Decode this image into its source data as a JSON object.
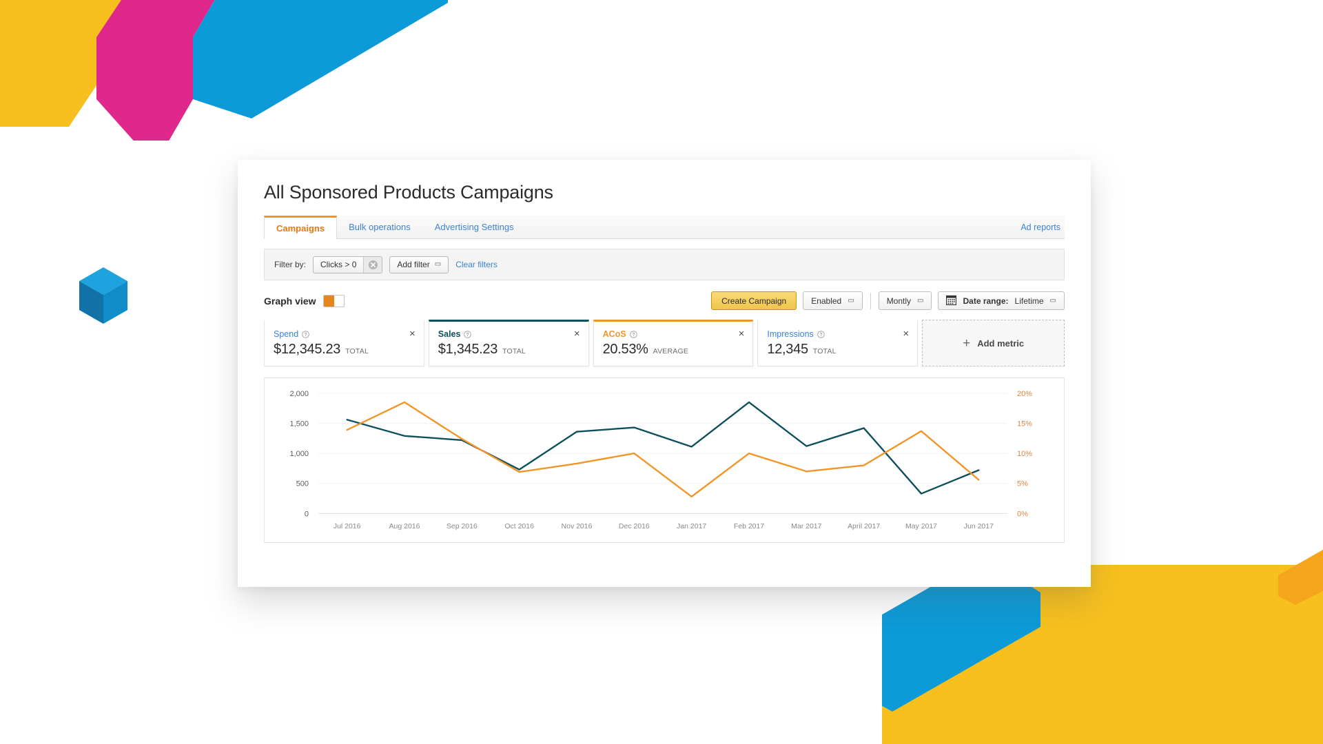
{
  "page": {
    "title": "All Sponsored Products Campaigns"
  },
  "tabs": [
    {
      "label": "Campaigns",
      "active": true
    },
    {
      "label": "Bulk operations",
      "active": false
    },
    {
      "label": "Advertising Settings",
      "active": false
    }
  ],
  "tab_right_link": "Ad reports",
  "filter_bar": {
    "label": "Filter by:",
    "chips": [
      {
        "label": "Clicks > 0"
      }
    ],
    "add_filter": "Add filter",
    "clear_filters": "Clear filters"
  },
  "graph_row": {
    "label": "Graph view",
    "toggle_state": "on",
    "create_campaign": "Create Campaign",
    "status_filter": "Enabled",
    "granularity": "Montly",
    "date_range_label": "Date range:",
    "date_range_value": "Lifetime"
  },
  "metrics": [
    {
      "name": "Spend",
      "value": "$12,345.23",
      "unit": "TOTAL",
      "color": "#3c82d4",
      "state": "link",
      "close": "×"
    },
    {
      "name": "Sales",
      "value": "$1,345.23",
      "unit": "TOTAL",
      "color": "#0d4f5c",
      "state": "teal",
      "close": "×"
    },
    {
      "name": "ACoS",
      "value": "20.53%",
      "unit": "AVERAGE",
      "color": "#f0952a",
      "state": "orange",
      "close": "×"
    },
    {
      "name": "Impressions",
      "value": "12,345",
      "unit": "TOTAL",
      "color": "#3c82d4",
      "state": "link",
      "close": "×"
    }
  ],
  "add_metric": {
    "label": "Add metric",
    "plus": "+"
  },
  "chart_data": {
    "type": "line",
    "title": "",
    "xlabel": "",
    "ylabel": "",
    "grid": true,
    "legend": "none",
    "x": [
      "Jul 2016",
      "Aug 2016",
      "Sep 2016",
      "Oct 2016",
      "Nov 2016",
      "Dec 2016",
      "Jan 2017",
      "Feb 2017",
      "Mar 2017",
      "April 2017",
      "May 2017",
      "Jun 2017"
    ],
    "left_axis": {
      "ticks": [
        "0",
        "500",
        "1,000",
        "1,500",
        "2,000"
      ],
      "values": [
        0,
        500,
        1000,
        1500,
        2000
      ],
      "min": 0,
      "max": 2000,
      "color": "#5a5a5a"
    },
    "right_axis": {
      "ticks": [
        "0%",
        "5%",
        "10%",
        "15%",
        "20%"
      ],
      "values": [
        0,
        5,
        10,
        15,
        20
      ],
      "min": 0,
      "max": 20,
      "color": "#d98642"
    },
    "series": [
      {
        "name": "Sales",
        "axis": "left",
        "color": "#0d4f5c",
        "values": [
          1560,
          1290,
          1220,
          730,
          1360,
          1430,
          1110,
          1850,
          1120,
          1420,
          330,
          720
        ]
      },
      {
        "name": "ACoS",
        "axis": "right",
        "color": "#f29526",
        "values": [
          13.9,
          18.5,
          12.4,
          6.9,
          8.3,
          10.0,
          2.8,
          10.0,
          7.0,
          8.0,
          13.7,
          5.6
        ]
      }
    ]
  },
  "decor": {
    "yellow": "#F7C01E",
    "magenta": "#E0278C",
    "blue": "#0C9AD8",
    "blue_dark": "#1B7FB5",
    "orange_shadow": "#F4A51C"
  }
}
